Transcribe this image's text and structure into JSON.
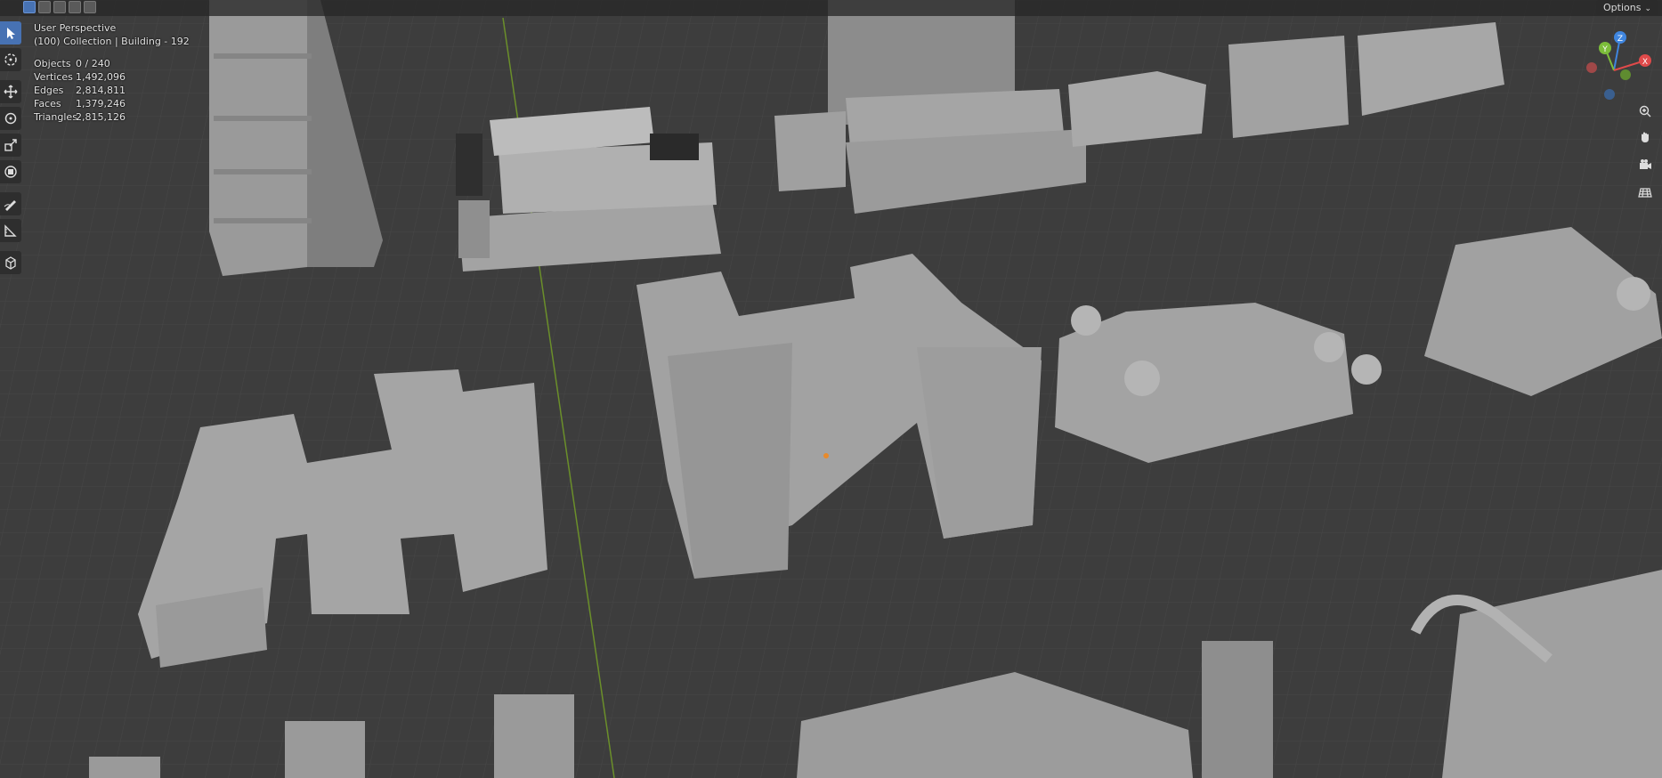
{
  "header": {
    "options_label": "Options",
    "select_modes": [
      "select-new",
      "select-extend",
      "select-subtract",
      "select-invert",
      "select-intersect"
    ]
  },
  "toolbar": {
    "tools": [
      "select-box-icon",
      "cursor-icon",
      "move-icon",
      "rotate-icon",
      "scale-icon",
      "transform-icon",
      "annotate-icon",
      "measure-icon",
      "add-cube-icon"
    ],
    "active_tool": "select-box-icon"
  },
  "overlay": {
    "perspective": "User Perspective",
    "collection": "(100) Collection | Building - 192",
    "stats": [
      {
        "label": "Objects",
        "value": "0 / 240"
      },
      {
        "label": "Vertices",
        "value": "1,492,096"
      },
      {
        "label": "Edges",
        "value": "2,814,811"
      },
      {
        "label": "Faces",
        "value": "1,379,246"
      },
      {
        "label": "Triangles",
        "value": "2,815,126"
      }
    ]
  },
  "gizmo": {
    "axes": [
      "Z",
      "Y",
      "X"
    ],
    "colors": {
      "x": "#e04a4a",
      "y": "#7cbd3a",
      "z": "#3f86e0"
    }
  },
  "navigation": [
    "zoom-icon",
    "pan-hand-icon",
    "camera-icon",
    "grid-view-icon"
  ],
  "colors": {
    "background": "#3d3d3d",
    "grid": "#4a4a4a",
    "building": "#9c9c9c",
    "active_tool": "#4772b3",
    "y_axis_line": "#6b8f2a"
  }
}
